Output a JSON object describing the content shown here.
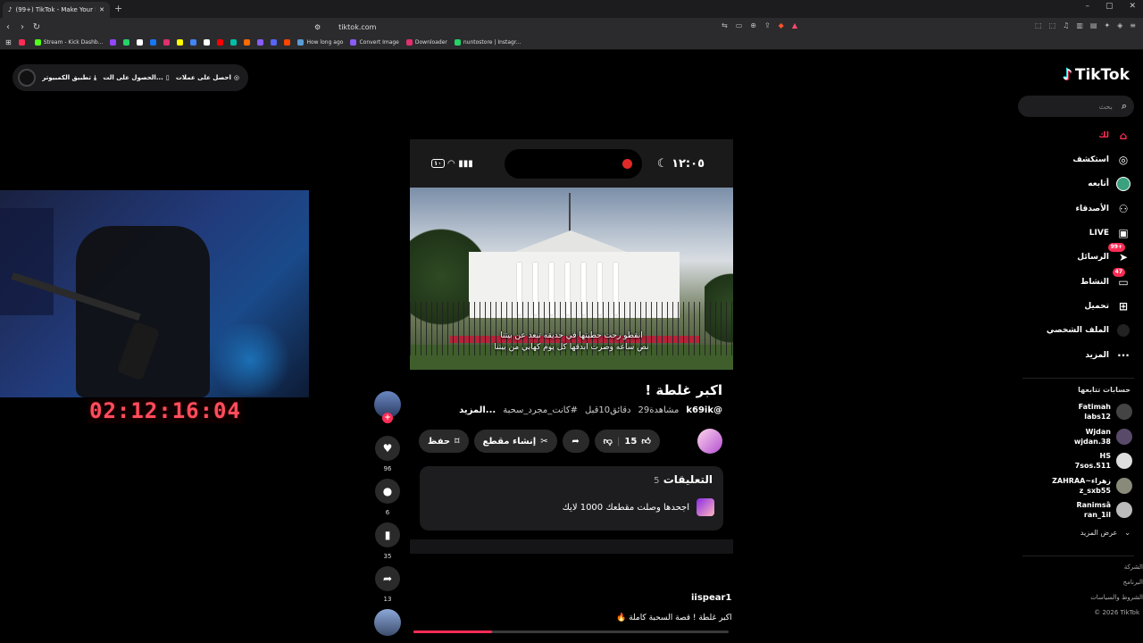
{
  "browser": {
    "tab_title": "(99+) TikTok - Make Your Day",
    "new_tab": "+",
    "url": "tiktok.com",
    "window_controls": [
      "–",
      "▢",
      "✕"
    ],
    "bookmarks": [
      {
        "label": "",
        "color": "#ff2d55"
      },
      {
        "label": "Stream - Kick Dashb...",
        "color": "#53fc18"
      },
      {
        "label": "",
        "color": "#9146ff"
      },
      {
        "label": "",
        "color": "#25d366"
      },
      {
        "label": "",
        "color": "#ffffff"
      },
      {
        "label": "",
        "color": "#1877f2"
      },
      {
        "label": "",
        "color": "#e1306c"
      },
      {
        "label": "",
        "color": "#fffc00"
      },
      {
        "label": "",
        "color": "#4285f4"
      },
      {
        "label": "",
        "color": "#ffffff"
      },
      {
        "label": "",
        "color": "#ff0000"
      },
      {
        "label": "",
        "color": "#00bfa5"
      },
      {
        "label": "",
        "color": "#ff6a00"
      },
      {
        "label": "",
        "color": "#8a5cf6"
      },
      {
        "label": "",
        "color": "#5865f2"
      },
      {
        "label": "",
        "color": "#ff4500"
      },
      {
        "label": "How long ago",
        "color": "#5b9bd5"
      },
      {
        "label": "Convert Image",
        "color": "#8a5cf6"
      },
      {
        "label": "Downloader",
        "color": "#e1306c"
      },
      {
        "label": "nuntostore | Instagr...",
        "color": "#25d366"
      }
    ]
  },
  "promo": {
    "coins": "احصل على عملات",
    "get_app": "الحصول على الت...",
    "pc_app": "تطبيق الكمبيوتر"
  },
  "stream": {
    "timer": "02:12:16:04"
  },
  "video": {
    "status_time": "١٢:٠٥",
    "status_battery": "١٠",
    "caption_line1": "انقطو رحت حطيتها في حديقه تبعد عن بيتنا",
    "caption_line2": "نص ساعه وصرت ابدقها كل يوم كهابي من بيتنا",
    "title": "اكبر غلطة !",
    "username": "@k69ik",
    "views": "مشاهدة29",
    "time_ago": "دقائق10قبل",
    "hashtag": "#كانت_مجرد_سحبة",
    "more": "...المزيد",
    "likes": "15",
    "create_clip": "إنشاء مقطع",
    "save": "حفظ",
    "comments_title": "التعليقات",
    "comments_count": "5",
    "first_comment": "اجحدها وصلت مقطعك 1000 لايك",
    "progress": 0.25
  },
  "rail": {
    "likes": "96",
    "comments": "6",
    "saves": "35",
    "shares": "13"
  },
  "next_video": {
    "username": "iispear1",
    "caption": "اكبر غلطة ! قصة السحبة كاملة 🔥"
  },
  "sidebar": {
    "logo": "TikTok",
    "search_placeholder": "بحث",
    "nav": [
      {
        "label": "لك",
        "icon": "home-icon"
      },
      {
        "label": "استكشف",
        "icon": "compass-icon"
      },
      {
        "label": "أتابعه",
        "icon": "following-avatar-icon"
      },
      {
        "label": "الأصدقاء",
        "icon": "friends-icon"
      },
      {
        "label": "LIVE",
        "icon": "live-icon"
      },
      {
        "label": "الرسائل",
        "icon": "messages-icon",
        "badge": "99+"
      },
      {
        "label": "النشاط",
        "icon": "activity-icon",
        "badge": "47"
      },
      {
        "label": "تحميل",
        "icon": "upload-icon"
      },
      {
        "label": "الملف الشخصي",
        "icon": "profile-avatar-icon"
      },
      {
        "label": "المزيد",
        "icon": "more-icon"
      }
    ],
    "following_header": "حسابات تتابعها",
    "following": [
      {
        "name": "Fatimah",
        "handle": "labs12"
      },
      {
        "name": "Wjdan",
        "handle": "wjdan.38"
      },
      {
        "name": "HS",
        "handle": "7sos.511"
      },
      {
        "name": "ZAHRAA~زهراء",
        "handle": "z_sxb55"
      },
      {
        "name": "Ranimsȁ",
        "handle": "ran_1il"
      }
    ],
    "see_more": "عرض المزيد",
    "footer": [
      "الشركة",
      "البرنامج",
      "الشروط والسياسات",
      "© 2026 TikTok"
    ]
  },
  "colors": {
    "accent": "#fe2c55",
    "timer": "#ff4d5e",
    "background": "#000000"
  }
}
